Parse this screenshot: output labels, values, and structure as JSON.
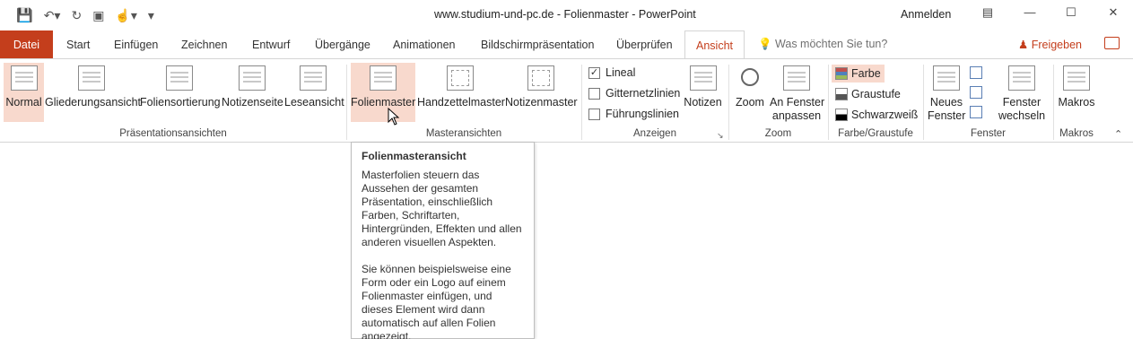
{
  "window": {
    "title": "www.studium-und-pc.de - Folienmaster  -  PowerPoint",
    "signin": "Anmelden",
    "qat": [
      "save-icon",
      "undo-icon",
      "redo-icon",
      "present-icon",
      "touch-icon",
      "customize-icon"
    ]
  },
  "tabs": {
    "file": "Datei",
    "items": [
      "Start",
      "Einfügen",
      "Zeichnen",
      "Entwurf",
      "Übergänge",
      "Animationen",
      "Bildschirmpräsentation",
      "Überprüfen"
    ],
    "active": "Ansicht",
    "search": "Was möchten Sie tun?",
    "share": "Freigeben"
  },
  "ribbon": {
    "presentation_views": {
      "label": "Präsentationsansichten",
      "buttons": [
        "Normal",
        "Gliederungsansicht",
        "Foliensortierung",
        "Notizenseite",
        "Leseansicht"
      ]
    },
    "master_views": {
      "label": "Masteransichten",
      "buttons": [
        "Folienmaster",
        "Handzettelmaster",
        "Notizenmaster"
      ]
    },
    "show": {
      "label": "Anzeigen",
      "ruler": "Lineal",
      "gridlines": "Gitternetzlinien",
      "guides": "Führungslinien",
      "notes": "Notizen"
    },
    "zoom": {
      "label": "Zoom",
      "zoom": "Zoom",
      "fit_line1": "An Fenster",
      "fit_line2": "anpassen"
    },
    "color": {
      "label": "Farbe/Graustufe",
      "color": "Farbe",
      "grayscale": "Graustufe",
      "bw": "Schwarzweiß"
    },
    "window": {
      "label": "Fenster",
      "new_line1": "Neues",
      "new_line2": "Fenster",
      "switch_line1": "Fenster",
      "switch_line2": "wechseln"
    },
    "macros": {
      "label": "Makros",
      "macros": "Makros"
    }
  },
  "tooltip": {
    "title": "Folienmasteransicht",
    "p1": "Masterfolien steuern das Aussehen der gesamten Präsentation, einschließlich Farben, Schriftarten, Hintergründen, Effekten und allen anderen visuellen Aspekten.",
    "p2": "Sie können beispielsweise eine Form oder ein Logo auf einem Folienmaster einfügen, und dieses Element wird dann automatisch auf allen Folien angezeigt."
  },
  "colors": {
    "accent": "#c43e1c",
    "selected": "#f8d9cd"
  }
}
